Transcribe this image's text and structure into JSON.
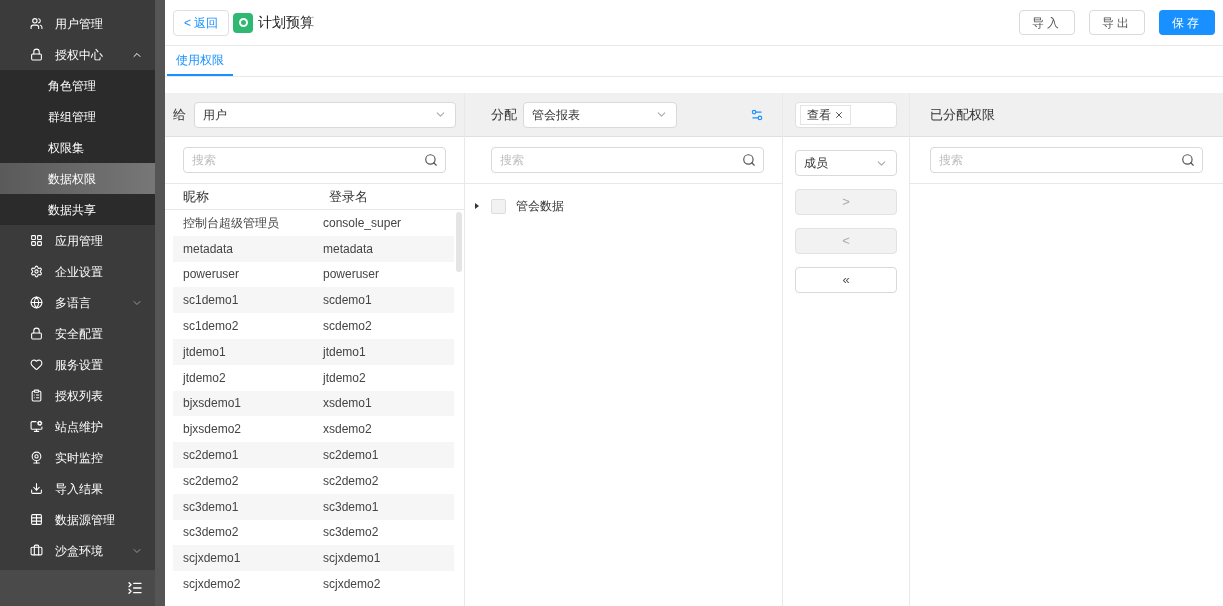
{
  "sidebar": {
    "items": [
      {
        "label": "用户管理",
        "selected": false
      },
      {
        "label": "授权中心",
        "selected": false,
        "expanded": true,
        "children": [
          {
            "label": "角色管理",
            "selected": false
          },
          {
            "label": "群组管理",
            "selected": false
          },
          {
            "label": "权限集",
            "selected": false
          },
          {
            "label": "数据权限",
            "selected": true
          },
          {
            "label": "数据共享",
            "selected": false
          }
        ]
      },
      {
        "label": "应用管理",
        "selected": false
      },
      {
        "label": "企业设置",
        "selected": false
      },
      {
        "label": "多语言",
        "selected": false,
        "expanded": false
      },
      {
        "label": "安全配置",
        "selected": false
      },
      {
        "label": "服务设置",
        "selected": false
      },
      {
        "label": "授权列表",
        "selected": false
      },
      {
        "label": "站点维护",
        "selected": false
      },
      {
        "label": "实时监控",
        "selected": false
      },
      {
        "label": "导入结果",
        "selected": false
      },
      {
        "label": "数据源管理",
        "selected": false
      },
      {
        "label": "沙盒环境",
        "selected": false,
        "expanded": false
      }
    ]
  },
  "header": {
    "back": "< 返回",
    "title": "计划预算",
    "buttons": [
      {
        "label": "导入",
        "kind": "default"
      },
      {
        "label": "导出",
        "kind": "default"
      },
      {
        "label": "保存",
        "kind": "primary"
      }
    ]
  },
  "tabs": [
    {
      "label": "使用权限",
      "selected": true
    }
  ],
  "grant_panel": {
    "label": "给",
    "select": "用户",
    "search": {
      "placeholder": "搜索"
    },
    "columns": [
      "昵称",
      "登录名"
    ],
    "rows": [
      [
        "控制台超级管理员",
        "console_super"
      ],
      [
        "metadata",
        "metadata"
      ],
      [
        "poweruser",
        "poweruser"
      ],
      [
        "sc1demo1",
        "scdemo1"
      ],
      [
        "sc1demo2",
        "scdemo2"
      ],
      [
        "jtdemo1",
        "jtdemo1"
      ],
      [
        "jtdemo2",
        "jtdemo2"
      ],
      [
        "bjxsdemo1",
        "xsdemo1"
      ],
      [
        "bjxsdemo2",
        "xsdemo2"
      ],
      [
        "sc2demo1",
        "sc2demo1"
      ],
      [
        "sc2demo2",
        "sc2demo2"
      ],
      [
        "sc3demo1",
        "sc3demo1"
      ],
      [
        "sc3demo2",
        "sc3demo2"
      ],
      [
        "scjxdemo1",
        "scjxdemo1"
      ],
      [
        "scjxdemo2",
        "scjxdemo2"
      ]
    ]
  },
  "assign_panel": {
    "label": "分配",
    "select": "管会报表",
    "search": {
      "placeholder": "搜索"
    },
    "tree": [
      {
        "label": "管会数据",
        "checked": false,
        "expanded": false
      }
    ]
  },
  "transfer": {
    "tags": [
      "查看"
    ],
    "select": "成员",
    "buttons": [
      {
        "label": ">",
        "disabled": true
      },
      {
        "label": "<",
        "disabled": true
      },
      {
        "label": "«",
        "disabled": false
      }
    ]
  },
  "assigned_panel": {
    "title": "已分配权限",
    "search": {
      "placeholder": "搜索"
    }
  }
}
